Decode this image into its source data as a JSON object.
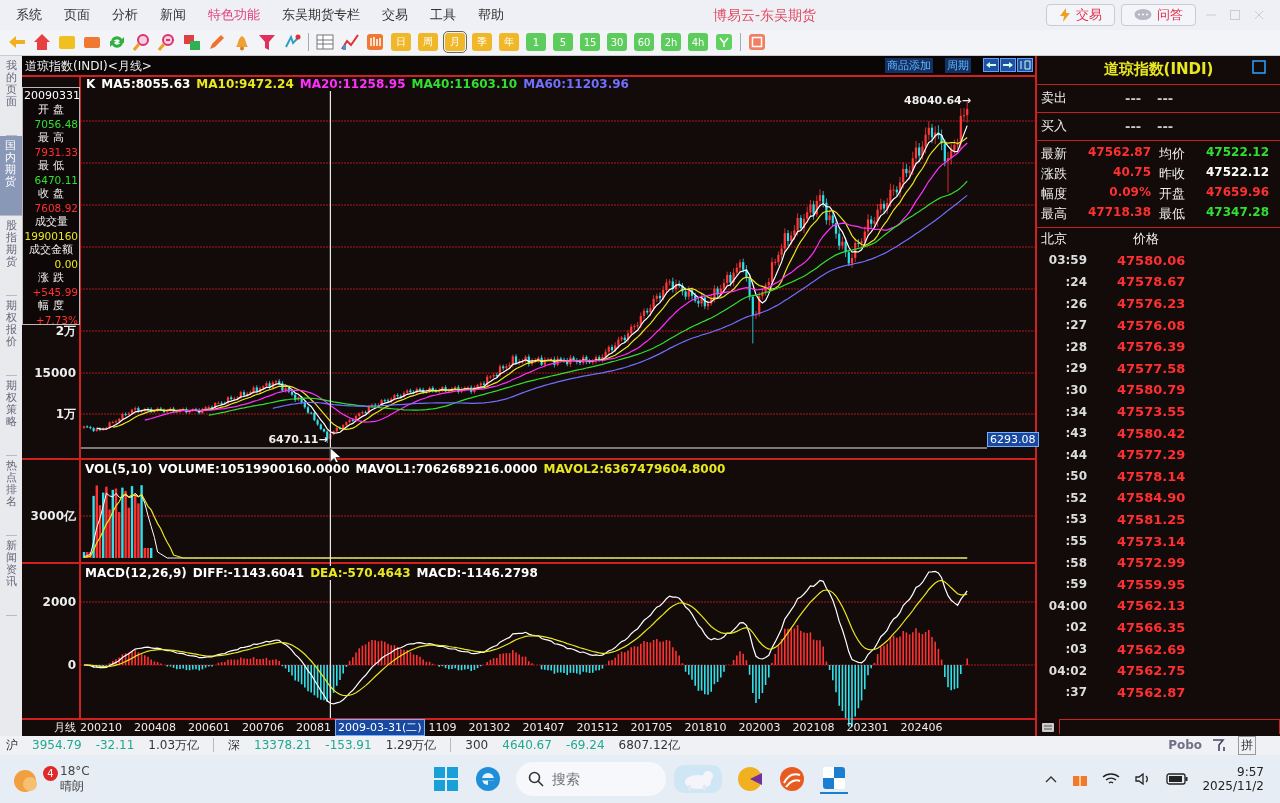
{
  "menu": [
    {
      "label": "系统",
      "highlighted": false
    },
    {
      "label": "页面",
      "highlighted": false
    },
    {
      "label": "分析",
      "highlighted": false
    },
    {
      "label": "新闻",
      "highlighted": false
    },
    {
      "label": "特色功能",
      "highlighted": true
    },
    {
      "label": "东吴期货专栏",
      "highlighted": false
    },
    {
      "label": "交易",
      "highlighted": false
    },
    {
      "label": "工具",
      "highlighted": false
    },
    {
      "label": "帮助",
      "highlighted": false
    }
  ],
  "window": {
    "title": "博易云-东吴期货"
  },
  "header_buttons": [
    {
      "label": "交易",
      "kind": "trade"
    },
    {
      "label": "问答",
      "kind": "chat"
    }
  ],
  "periods": [
    {
      "label": "日",
      "kind": "day",
      "selected": false
    },
    {
      "label": "周",
      "kind": "day",
      "selected": false
    },
    {
      "label": "月",
      "kind": "day",
      "selected": true
    },
    {
      "label": "季",
      "kind": "day",
      "selected": false
    },
    {
      "label": "年",
      "kind": "day",
      "selected": false
    },
    {
      "label": "1",
      "kind": "minute",
      "selected": false
    },
    {
      "label": "5",
      "kind": "minute",
      "selected": false
    },
    {
      "label": "15",
      "kind": "minute",
      "selected": false
    },
    {
      "label": "30",
      "kind": "minute",
      "selected": false
    },
    {
      "label": "60",
      "kind": "minute",
      "selected": false
    },
    {
      "label": "2h",
      "kind": "minute",
      "selected": false
    },
    {
      "label": "4h",
      "kind": "minute",
      "selected": false
    }
  ],
  "side_tabs": [
    {
      "label": "我的页面",
      "selected": false
    },
    {
      "label": "国内期货",
      "selected": true
    },
    {
      "label": "股指期货",
      "selected": false
    },
    {
      "label": "期权报价",
      "selected": false
    },
    {
      "label": "期权策略",
      "selected": false
    },
    {
      "label": "热点排名",
      "selected": false
    },
    {
      "label": "新闻资讯",
      "selected": false
    }
  ],
  "chart": {
    "title": "道琼指数(INDI)<月线>",
    "links": [
      "商品添加",
      "周期"
    ],
    "ma_legend": [
      {
        "label": "K",
        "color": "#ffffff"
      },
      {
        "label": "MA5:8055.63",
        "color": "#ffffff"
      },
      {
        "label": "MA10:9472.24",
        "color": "#e8e820"
      },
      {
        "label": "MA20:11258.95",
        "color": "#ff30ff"
      },
      {
        "label": "MA40:11603.10",
        "color": "#30e030"
      },
      {
        "label": "MA60:11203.96",
        "color": "#7070ff"
      }
    ],
    "info": {
      "date": "20090331",
      "items": [
        {
          "label": "开 盘",
          "value": "7056.48",
          "color": "#30e030"
        },
        {
          "label": "最 高",
          "value": "7931.33",
          "color": "#ff3030"
        },
        {
          "label": "最 低",
          "value": "6470.11",
          "color": "#30e030"
        },
        {
          "label": "收 盘",
          "value": "7608.92",
          "color": "#ff3030"
        },
        {
          "label": "成交量",
          "value": "19900160",
          "color": "#e8e820"
        },
        {
          "label": "成交金额",
          "value": "0.00",
          "color": "#e8e820"
        },
        {
          "label": "涨 跌",
          "value": "+545.99",
          "color": "#ff3030"
        },
        {
          "label": "幅 度",
          "value": "+7.73%",
          "color": "#ff3030"
        }
      ]
    },
    "y_labels": [
      "2万",
      "15000",
      "1万"
    ],
    "high_marker": "48040.64→",
    "low_marker": "6470.11→",
    "crosshair_price": "6293.08",
    "volume": {
      "legend": [
        {
          "label": "VOL(5,10)",
          "color": "#ffffff"
        },
        {
          "label": "VOLUME:10519900160.0000",
          "color": "#ffffff"
        },
        {
          "label": "MAVOL1:7062689216.0000",
          "color": "#ffffff"
        },
        {
          "label": "MAVOL2:6367479604.8000",
          "color": "#e8e820"
        }
      ],
      "y_label": "3000亿"
    },
    "macd": {
      "legend": [
        {
          "label": "MACD(12,26,9)",
          "color": "#ffffff"
        },
        {
          "label": "DIFF:-1143.6041",
          "color": "#ffffff"
        },
        {
          "label": "DEA:-570.4643",
          "color": "#e8e820"
        },
        {
          "label": "MACD:-1146.2798",
          "color": "#ffffff"
        }
      ],
      "y_labels": [
        "2000",
        "0"
      ]
    },
    "x_axis": {
      "label": "月线",
      "dates_before": [
        "200210",
        "200408",
        "200601",
        "200706",
        "20081"
      ],
      "crosshair_date": "2009-03-31(二)",
      "dates_after": [
        "1109",
        "201302",
        "201407",
        "201512",
        "201705",
        "201810",
        "202003",
        "202108",
        "202301",
        "202406"
      ]
    }
  },
  "quote_panel": {
    "title": "道琼指数(INDI)",
    "book": [
      {
        "label": "卖出",
        "values": [
          "---",
          "---"
        ]
      },
      {
        "label": "买入",
        "values": [
          "---",
          "---"
        ]
      }
    ],
    "fields": [
      {
        "label": "最新",
        "value": "47562.87",
        "color": "#ff3030"
      },
      {
        "label": "均价",
        "value": "47522.12",
        "color": "#30e030"
      },
      {
        "label": "涨跌",
        "value": "40.75",
        "color": "#ff3030"
      },
      {
        "label": "昨收",
        "value": "47522.12",
        "color": "#ffffff"
      },
      {
        "label": "幅度",
        "value": "0.09%",
        "color": "#ff3030"
      },
      {
        "label": "开盘",
        "value": "47659.96",
        "color": "#ff3030"
      },
      {
        "label": "最高",
        "value": "47718.38",
        "color": "#ff3030"
      },
      {
        "label": "最低",
        "value": "47347.28",
        "color": "#30e030"
      }
    ],
    "ticks_header": [
      "北京",
      "价格"
    ],
    "ticks": [
      {
        "time": "03:59",
        "price": "47580.06"
      },
      {
        "time": ":24",
        "price": "47578.67"
      },
      {
        "time": ":26",
        "price": "47576.23"
      },
      {
        "time": ":27",
        "price": "47576.08"
      },
      {
        "time": ":28",
        "price": "47576.39"
      },
      {
        "time": ":29",
        "price": "47577.58"
      },
      {
        "time": ":30",
        "price": "47580.79"
      },
      {
        "time": ":34",
        "price": "47573.55"
      },
      {
        "time": ":43",
        "price": "47580.42"
      },
      {
        "time": ":44",
        "price": "47577.29"
      },
      {
        "time": ":50",
        "price": "47578.14"
      },
      {
        "time": ":52",
        "price": "47584.90"
      },
      {
        "time": ":53",
        "price": "47581.25"
      },
      {
        "time": ":55",
        "price": "47573.14"
      },
      {
        "time": ":58",
        "price": "47572.99"
      },
      {
        "time": ":59",
        "price": "47559.95"
      },
      {
        "time": "04:00",
        "price": "47562.13"
      },
      {
        "time": ":02",
        "price": "47566.35"
      },
      {
        "time": ":03",
        "price": "47562.69"
      },
      {
        "time": "04:02",
        "price": "47562.75"
      },
      {
        "time": ":37",
        "price": "47562.87"
      }
    ]
  },
  "status_bar": {
    "indices": [
      {
        "label": "沪",
        "price": "3954.79",
        "change": "-32.11",
        "amount": "1.03万亿",
        "color": "#20a890"
      },
      {
        "label": "深",
        "price": "13378.21",
        "change": "-153.91",
        "amount": "1.29万亿",
        "color": "#20a890"
      },
      {
        "label": "300",
        "price": "4640.67",
        "change": "-69.24",
        "amount": "6807.12亿",
        "color": "#20a890"
      }
    ],
    "brand": "Pobo",
    "ime": "拼"
  },
  "taskbar": {
    "weather": {
      "badge": "4",
      "temperature": "18°C",
      "condition": "晴朗"
    },
    "search": {
      "placeholder": "搜索"
    },
    "clock": {
      "time": "9:57",
      "date": "2025/11/2"
    }
  }
}
